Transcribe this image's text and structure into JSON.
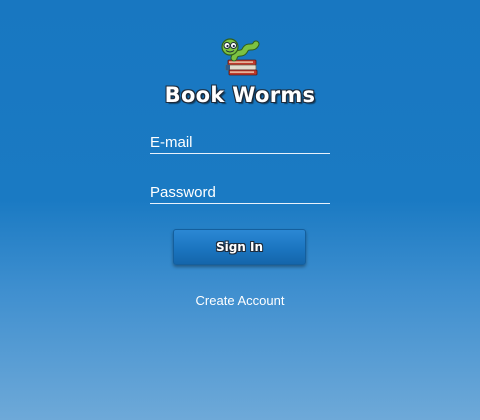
{
  "app": {
    "title": "Book Worms",
    "logo_icon": "bookworm-on-books-icon"
  },
  "login_form": {
    "email_placeholder": "E-mail",
    "email_value": "",
    "password_placeholder": "Password",
    "password_value": "",
    "sign_in_label": "Sign In",
    "create_account_label": "Create Account"
  },
  "colors": {
    "background_top": "#1877c1",
    "background_bottom": "#6ea9d8",
    "button": "#1b75c0",
    "text": "#ffffff"
  }
}
